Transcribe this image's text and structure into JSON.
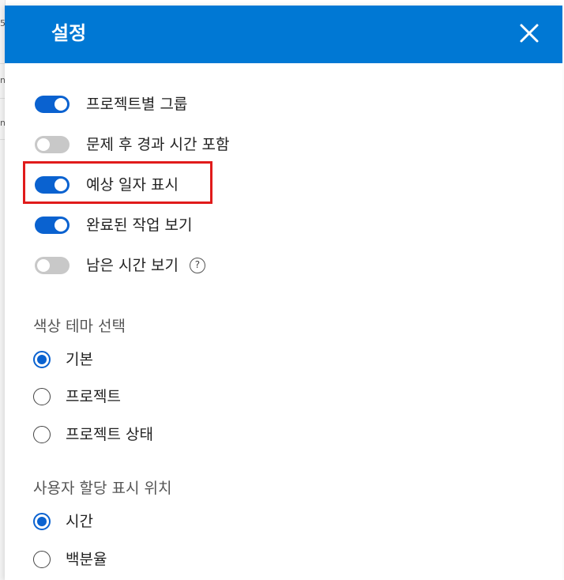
{
  "background_fragments": [
    "5",
    "n",
    "n"
  ],
  "header": {
    "title": "설정",
    "close_icon": "close-icon",
    "bg_color": "#0078d4"
  },
  "toggles": [
    {
      "label": "프로젝트별 그룹",
      "on": true
    },
    {
      "label": "문제 후 경과 시간 포함",
      "on": false
    },
    {
      "label": "예상 일자 표시",
      "on": true
    },
    {
      "label": "완료된 작업 보기",
      "on": true
    },
    {
      "label": "남은 시간 보기",
      "on": false,
      "help": "?"
    }
  ],
  "color_theme": {
    "title": "색상 테마 선택",
    "options": [
      {
        "label": "기본",
        "checked": true
      },
      {
        "label": "프로젝트",
        "checked": false
      },
      {
        "label": "프로젝트 상태",
        "checked": false
      }
    ]
  },
  "assignment_display": {
    "title": "사용자 할당 표시 위치",
    "options": [
      {
        "label": "시간",
        "checked": true
      },
      {
        "label": "백분율",
        "checked": false
      }
    ]
  },
  "colors": {
    "accent": "#0a62d0",
    "toggle_off": "#c8c8c8",
    "highlight": "#e01b1b"
  }
}
